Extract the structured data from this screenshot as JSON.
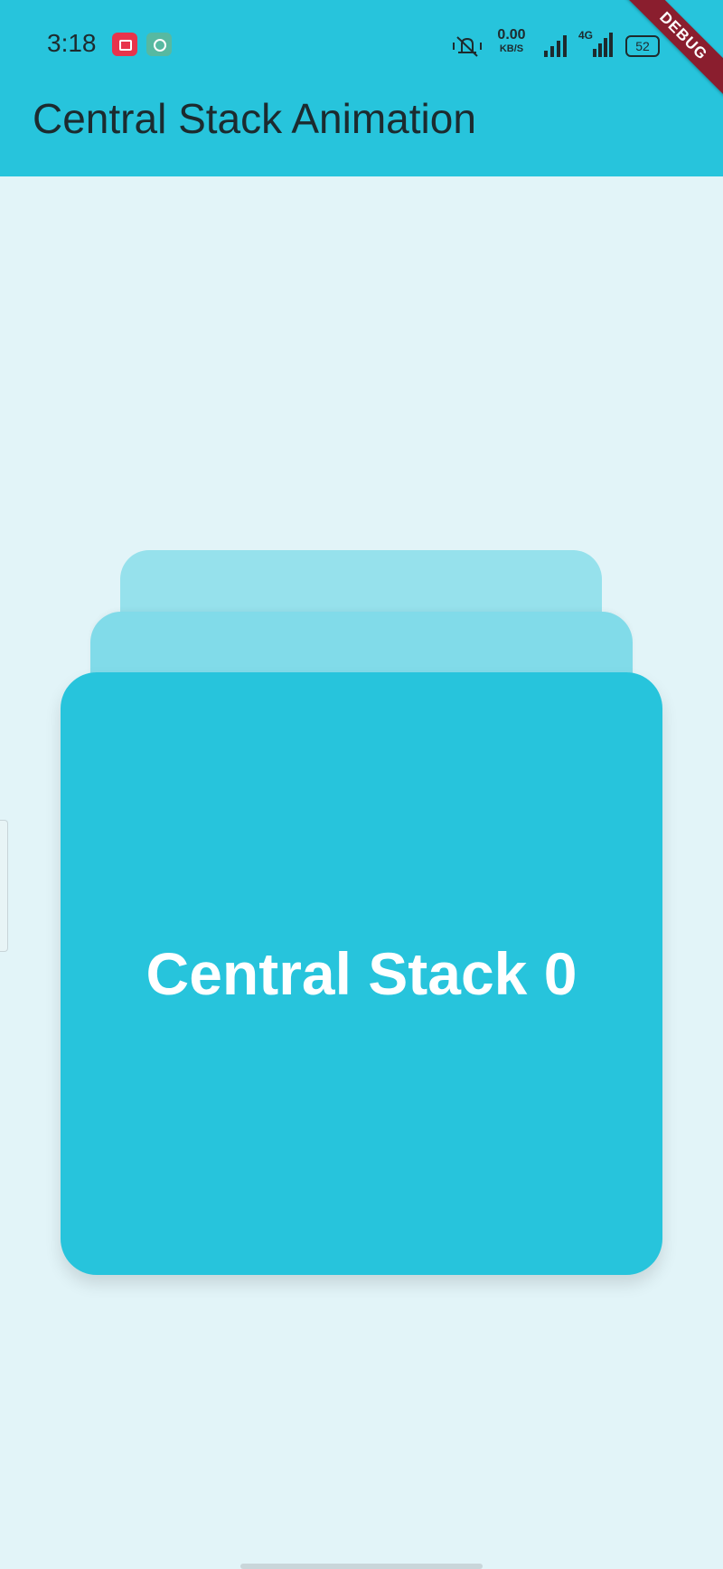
{
  "status_bar": {
    "time": "3:18",
    "net_speed_value": "0.00",
    "net_speed_unit": "KB/S",
    "network_type": "4G",
    "battery": "52",
    "notification_icons": [
      "screen-record-icon",
      "chat-bubble-icon"
    ],
    "system_icons": [
      "mute-icon",
      "signal-icon",
      "signal-4g-icon",
      "battery-icon"
    ]
  },
  "debug_banner": "DEBUG",
  "app_bar": {
    "title": "Central Stack Animation"
  },
  "cards": {
    "front_label": "Central Stack 0"
  },
  "colors": {
    "primary": "#27c4dc",
    "background": "#e2f4f8",
    "card_middle": "#81dbe9",
    "card_back": "#96e1ec"
  }
}
